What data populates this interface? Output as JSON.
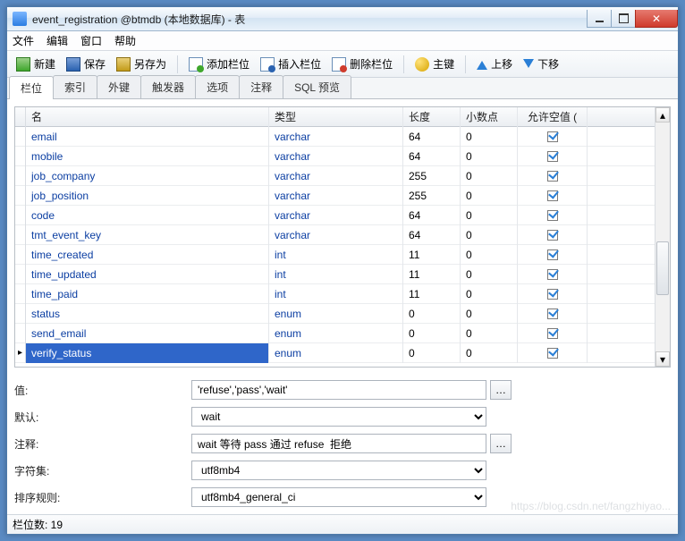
{
  "title": "event_registration @btmdb (本地数据库) - 表",
  "menu": [
    "文件",
    "编辑",
    "窗口",
    "帮助"
  ],
  "toolbar": {
    "new": "新建",
    "save": "保存",
    "saveas": "另存为",
    "addfield": "添加栏位",
    "insfield": "插入栏位",
    "delfield": "删除栏位",
    "pk": "主键",
    "up": "上移",
    "down": "下移"
  },
  "tabs": [
    "栏位",
    "索引",
    "外键",
    "触发器",
    "选项",
    "注释",
    "SQL 预览"
  ],
  "active_tab": 0,
  "columns_header": {
    "name": "名",
    "type": "类型",
    "len": "长度",
    "dec": "小数点",
    "null": "允许空值 ("
  },
  "rows": [
    {
      "name": "email",
      "type": "varchar",
      "len": "64",
      "dec": "0",
      "null": true
    },
    {
      "name": "mobile",
      "type": "varchar",
      "len": "64",
      "dec": "0",
      "null": true
    },
    {
      "name": "job_company",
      "type": "varchar",
      "len": "255",
      "dec": "0",
      "null": true
    },
    {
      "name": "job_position",
      "type": "varchar",
      "len": "255",
      "dec": "0",
      "null": true
    },
    {
      "name": "code",
      "type": "varchar",
      "len": "64",
      "dec": "0",
      "null": true
    },
    {
      "name": "tmt_event_key",
      "type": "varchar",
      "len": "64",
      "dec": "0",
      "null": true
    },
    {
      "name": "time_created",
      "type": "int",
      "len": "11",
      "dec": "0",
      "null": true
    },
    {
      "name": "time_updated",
      "type": "int",
      "len": "11",
      "dec": "0",
      "null": true
    },
    {
      "name": "time_paid",
      "type": "int",
      "len": "11",
      "dec": "0",
      "null": true
    },
    {
      "name": "status",
      "type": "enum",
      "len": "0",
      "dec": "0",
      "null": true
    },
    {
      "name": "send_email",
      "type": "enum",
      "len": "0",
      "dec": "0",
      "null": true
    },
    {
      "name": "verify_status",
      "type": "enum",
      "len": "0",
      "dec": "0",
      "null": true,
      "selected": true
    }
  ],
  "details": {
    "labels": {
      "value": "值:",
      "default": "默认:",
      "comment": "注释:",
      "charset": "字符集:",
      "collation": "排序规则:"
    },
    "value": "'refuse','pass','wait'",
    "default": "wait",
    "comment": "wait 等待 pass 通过 refuse  拒绝",
    "charset": "utf8mb4",
    "collation": "utf8mb4_general_ci"
  },
  "status": "栏位数: 19",
  "watermark": "https://blog.csdn.net/fangzhiyao..."
}
